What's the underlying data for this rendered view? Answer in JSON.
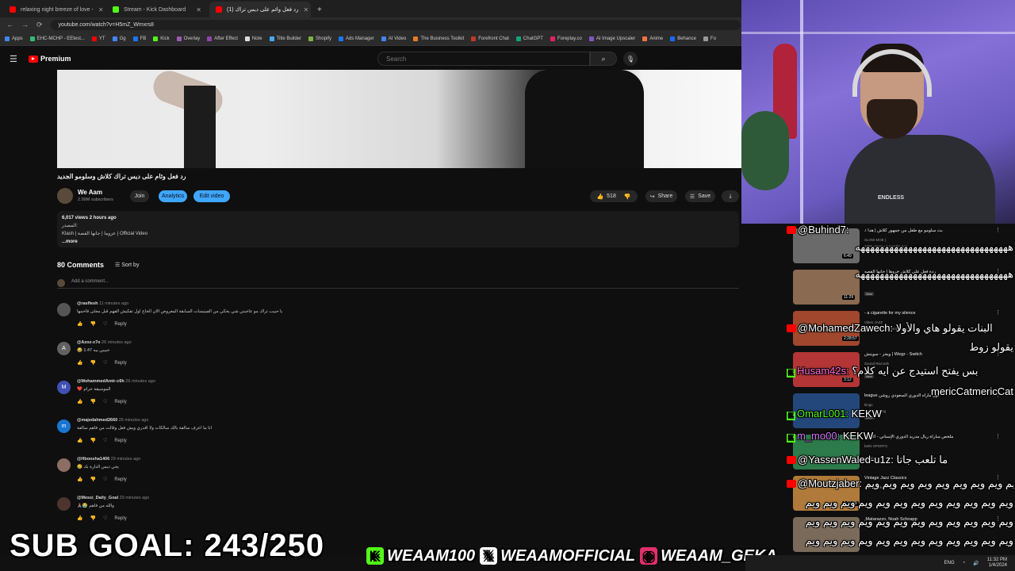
{
  "browser": {
    "tabs": [
      {
        "title": "relaxing night breeze of love -",
        "icon_color": "#ff0000"
      },
      {
        "title": "Stream - Kick Dashboard",
        "icon_color": "#53fc18"
      },
      {
        "title": "(1) رد فعل وائم على ديس تراك",
        "icon_color": "#ff0000"
      }
    ],
    "new_tab": "+",
    "url": "youtube.com/watch?v=H5mZ_Wmxrs8",
    "bookmarks": [
      "Apps",
      "EHC-MCHP - EEtest...",
      "YT",
      "Gg",
      "FB",
      "Kick",
      "Overlay",
      "After Effect",
      "Note",
      "Title Builder",
      "Shopify",
      "Ads Manager",
      "AI Video",
      "The Business Toolkit",
      "Forefront Chat",
      "ChatGPT",
      "Foreplay.co",
      "AI Image Upscaler",
      "Anime",
      "Behance",
      "Fo"
    ]
  },
  "youtube": {
    "logo_text": "Premium",
    "search_placeholder": "Search",
    "video_title": "رد فعل وئام على ديس تراك كلاش وسلومو الجديد",
    "channel": {
      "name": "We Aam",
      "subs": "2.99M subscribers"
    },
    "buttons": {
      "join": "Join",
      "analytics": "Analytics",
      "edit": "Edit video",
      "likes": "518",
      "share": "Share",
      "save": "Save"
    },
    "description": {
      "meta": "6,017 views  2 hours ago",
      "line1": "المصدر:",
      "line2": "Klash | عزوما | جانها القصة | Official Video",
      "more": "...more"
    },
    "comments_count": "80 Comments",
    "sort_by": "Sort by",
    "add_comment": "Add a comment...",
    "reply_label": "Reply",
    "comments": [
      {
        "author": "@rasflesh",
        "time": "11 minutes ago",
        "text": "يا حبيب تراك مو عاجبني شي يحكي من الفينيسات السابقة المعروض الان الحاج اول تفكيش الفهم قبل مجلى قاحمها",
        "avatar_letter": "",
        "avatar_color": "#555555"
      },
      {
        "author": "@Azoz-x7o",
        "time": "26 minutes ago",
        "text": "😂 حبيبي يبه 1:47",
        "avatar_letter": "A",
        "avatar_color": "#616161"
      },
      {
        "author": "@MohammedAmir-c6h",
        "time": "26 minutes ago",
        "text": "❤️ الموسيقة حرام",
        "avatar_letter": "M",
        "avatar_color": "#3f51b5"
      },
      {
        "author": "@majedahmed2660",
        "time": "26 minutes ago",
        "text": "انا ما اعرف سالفة بالك سالكات ولا اقدري ويش فعل وقالت من فاهم سالفة",
        "avatar_letter": "m",
        "avatar_color": "#1976d2"
      },
      {
        "author": "@Hboosha1406",
        "time": "29 minutes ago",
        "text": "😢 يحي ديس الدارة بك",
        "avatar_letter": "",
        "avatar_color": "#8d6e63"
      },
      {
        "author": "@Messi_Daily_Goal",
        "time": "29 minutes ago",
        "text": "🙏🏽😭 والله من فاهم",
        "avatar_letter": "",
        "avatar_color": "#4e342e"
      }
    ]
  },
  "recommendations": [
    {
      "title": "بث سلومو مع طفل من جمهور كلاش | هدا ♪",
      "channel": "SLOW MOE (",
      "views": "169K views • 4 months ago",
      "duration": "6:49",
      "thumb": "#6a6a6a"
    },
    {
      "title": "ردة فعل على كلاش خروها | جانها القصه",
      "channel": "",
      "views": "",
      "duration": "11:29",
      "badge": "New",
      "thumb": "#8a6a50"
    },
    {
      "title": "a cigarette for my silence -",
      "channel": "Vibes JAZZ",
      "views": "896K views • 3 months ago",
      "duration": "2:28:57",
      "thumb": "#a0472e"
    },
    {
      "title": "Wegz - Switch | ويجز - سويتش",
      "channel": "Sound Records",
      "views": "",
      "duration": "3:12",
      "badge": "New",
      "thumb": "#b43535"
    },
    {
      "title": "اول ماراه الدوري السعودي روشن league",
      "channel": "kings",
      "views": "40K watching",
      "duration": "",
      "badge": "LIVE",
      "thumb": "#23477a"
    },
    {
      "title": "ملخص مباراة ريال مدريد الدوري الإسباني - الجولة",
      "channel": "beIN SPORTS",
      "views": "",
      "duration": "",
      "badge": "New",
      "thumb": "#2d7a4a"
    },
    {
      "title": "Vintage Jazz Classics",
      "channel": "Jazz Smoky",
      "views": "",
      "duration": "1:16:29",
      "thumb": "#b07a3a"
    },
    {
      "title": "Matarazzo, Noah Schnapp,",
      "channel": "",
      "views": "",
      "duration": "",
      "thumb": "#7a6a5a"
    }
  ],
  "chat": [
    {
      "platform": "yt",
      "user": "@Buhind7:",
      "msg": "",
      "color": "#ffffff"
    },
    {
      "platform": "",
      "user": "",
      "msg": "ههههههههههههههههههههههههههههههههه",
      "color": "#ffffff"
    },
    {
      "platform": "",
      "user": "",
      "msg": "ههههههههههههههههههههههههههههههههه",
      "color": "#ffffff"
    },
    {
      "platform": "yt",
      "user": "@MohamedZawech:",
      "msg": "البنات يقولو هاي والأولا",
      "color": "#ffffff"
    },
    {
      "platform": "",
      "user": "",
      "msg": "يقولو زوط",
      "color": "#ffffff"
    },
    {
      "platform": "kick",
      "user": "Husam42s:",
      "msg": "بس يفتح استيدج عن ايه كلام؟",
      "color": "#ff6bd6"
    },
    {
      "platform": "",
      "user": "",
      "msg": "mericCatmericCat",
      "color": "#ffffff"
    },
    {
      "platform": "kick",
      "user": "OmarL001:",
      "msg": "KEKW",
      "color": "#53fc18"
    },
    {
      "platform": "kick",
      "user": "m_mo00:",
      "msg": "KEKW",
      "color": "#d673ff"
    },
    {
      "platform": "yt",
      "user": "@YassenWaled-u1z:",
      "msg": "ما تلعب جاتا",
      "color": "#ffffff"
    },
    {
      "platform": "yt",
      "user": "@Moutzjaber:",
      "msg": "ويم ويم ويم ويم ويم ويم ويم ويم ويم",
      "color": "#ffffff"
    },
    {
      "platform": "",
      "user": "",
      "msg": "ويم ويم ويم ويم ويم ويم ويم ويم ويم ويم ويم ويم",
      "color": "#ffffff"
    },
    {
      "platform": "",
      "user": "",
      "msg": "ويم ويم ويم ويم ويم ويم ويم ويم ويم ويم ويم ويم",
      "color": "#ffffff"
    },
    {
      "platform": "",
      "user": "",
      "msg": "ويم ويم ويم ويم ويم ويم ويم ويم ويم ويم ويم ويم",
      "color": "#ffffff"
    }
  ],
  "overlay": {
    "sub_goal": "SUB GOAL: 243/250",
    "socials": [
      {
        "icon": "kick-icon",
        "handle": "WEAAM100",
        "color": "#53fc18"
      },
      {
        "icon": "x-icon",
        "handle": "WEAAMOFFICIAL",
        "color": "#ffffff"
      },
      {
        "icon": "instagram-icon",
        "handle": "WEAAM_GEKA",
        "color": "#e1306c"
      }
    ],
    "shirt_text": "ENDLESS",
    "clock": "11:32 PM",
    "date": "1/4/2024",
    "lang": "ENG"
  }
}
